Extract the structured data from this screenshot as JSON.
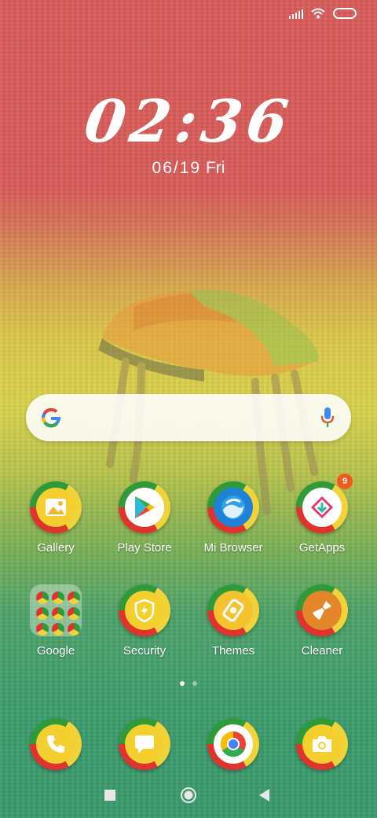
{
  "status_bar": {
    "signal_icon": "signal-icon",
    "wifi_icon": "wifi-icon",
    "battery_icon": "battery-icon"
  },
  "clock": {
    "time": "02:36",
    "date": "06/19",
    "day": "Fri"
  },
  "search_bar": {
    "google_icon": "google-g-icon",
    "mic_icon": "microphone-icon"
  },
  "apps_row1": [
    {
      "label": "Gallery",
      "icon": "gallery-icon"
    },
    {
      "label": "Play Store",
      "icon": "play-store-icon"
    },
    {
      "label": "Mi Browser",
      "icon": "mi-browser-icon"
    },
    {
      "label": "GetApps",
      "icon": "getapps-icon",
      "badge": "9"
    }
  ],
  "apps_row2": [
    {
      "label": "Google",
      "icon": "google-folder-icon"
    },
    {
      "label": "Security",
      "icon": "security-icon"
    },
    {
      "label": "Themes",
      "icon": "themes-icon"
    },
    {
      "label": "Cleaner",
      "icon": "cleaner-icon"
    }
  ],
  "dock": [
    {
      "icon": "phone-icon"
    },
    {
      "icon": "messages-icon"
    },
    {
      "icon": "chrome-icon"
    },
    {
      "icon": "camera-icon"
    }
  ],
  "page_indicator": {
    "pages": 2,
    "current": 1
  },
  "nav_bar": {
    "recents_icon": "recents-icon",
    "home_icon": "home-icon",
    "back_icon": "back-icon"
  },
  "colors": {
    "top": "#d95c5a",
    "middle": "#dcc84a",
    "bottom": "#3a9a6c",
    "ring_green": "#2f9a3a",
    "ring_yellow": "#f0d23a",
    "ring_red": "#e0332e",
    "badge": "#ef5a1d"
  }
}
